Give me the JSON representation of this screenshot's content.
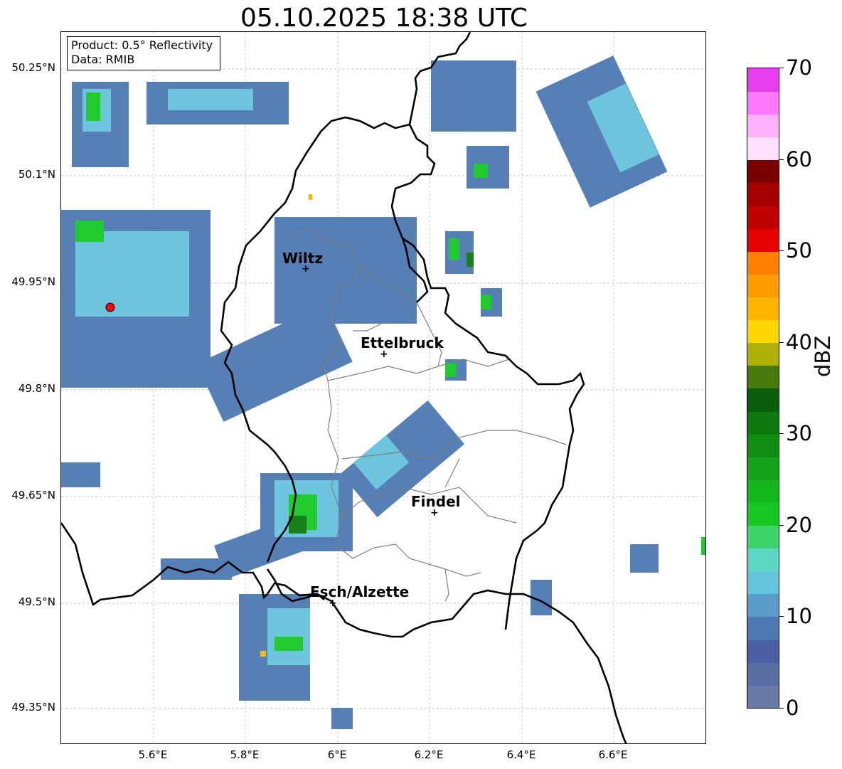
{
  "title": "05.10.2025 18:38 UTC",
  "info": {
    "product": "Product: 0.5° Reflectivity",
    "source": "Data: RMIB"
  },
  "lat_labels": [
    "50.25°N",
    "50.1°N",
    "49.95°N",
    "49.8°N",
    "49.65°N",
    "49.5°N",
    "49.35°N"
  ],
  "lon_labels": [
    "5.6°E",
    "5.8°E",
    "6°E",
    "6.2°E",
    "6.4°E",
    "6.6°E"
  ],
  "cities": [
    {
      "name": "Wiltz"
    },
    {
      "name": "Ettelbruck"
    },
    {
      "name": "Findel"
    },
    {
      "name": "Esch/Alzette"
    }
  ],
  "colorbar": {
    "unit": "dBZ",
    "tick_labels": [
      "0",
      "10",
      "20",
      "30",
      "40",
      "50",
      "60",
      "70"
    ],
    "colors": [
      "#6a7aa8",
      "#5a6ea6",
      "#4a60a2",
      "#4d79b2",
      "#5b9dc9",
      "#66c3dc",
      "#5dd6c3",
      "#3ed46c",
      "#16c824",
      "#13b81a",
      "#12a416",
      "#0f8e12",
      "#0c7a0f",
      "#0b5e0c",
      "#467a0a",
      "#aeb006",
      "#ffd700",
      "#ffb400",
      "#ff9c00",
      "#ff7f00",
      "#e60000",
      "#c00000",
      "#a40000",
      "#7a0000",
      "#ffe0ff",
      "#ffb0ff",
      "#ff78ff",
      "#e83cf0"
    ]
  },
  "map": {
    "border_color": "#000000",
    "canton_color": "#808080",
    "radar_color": "#ff0000"
  }
}
